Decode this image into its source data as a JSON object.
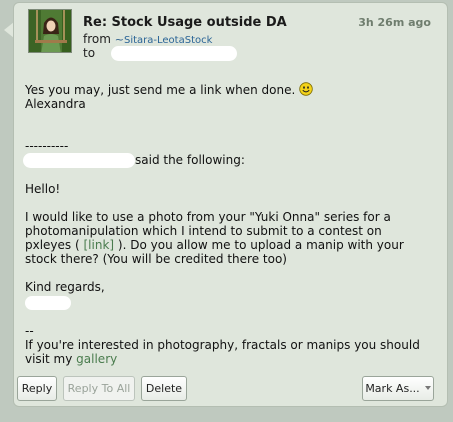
{
  "message": {
    "subject": "Re: Stock Usage outside DA",
    "timestamp": "3h 26m ago",
    "from_label": "from",
    "from_tilde": "~",
    "from_user": "Sitara-LeotaStock",
    "to_label": "to",
    "body": {
      "line1": "Yes you may, just send me a link when done.",
      "line2": "Alexandra",
      "separator": "----------",
      "said_following": "said the following:",
      "hello": "Hello!",
      "para1_a": "I would like to use a photo from your \"Yuki Onna\" series for a",
      "para1_b": "photomanipulation which I intend to submit to a contest on",
      "para1_c_pre": "pxleyes (",
      "link_label": "[link]",
      "para1_c_post": "). Do you allow me to upload a manip with your",
      "para1_d": "stock there? (You will be credited there too)",
      "closing": "Kind regards,",
      "sig_dash": "--",
      "sig_line1": "If you're interested in photography, fractals or manips you should",
      "sig_line2_pre": "visit my",
      "gallery_label": "gallery"
    }
  },
  "buttons": {
    "reply": "Reply",
    "reply_all": "Reply To All",
    "delete": "Delete",
    "mark_as": "Mark As..."
  },
  "icons": {
    "avatar": "avatar-photo",
    "smiley": "smiley-icon",
    "dropdown": "chevron-down-icon"
  },
  "colors": {
    "card_bg": "#dfe6dc",
    "link": "#4a7c4e",
    "username": "#2a6496"
  }
}
